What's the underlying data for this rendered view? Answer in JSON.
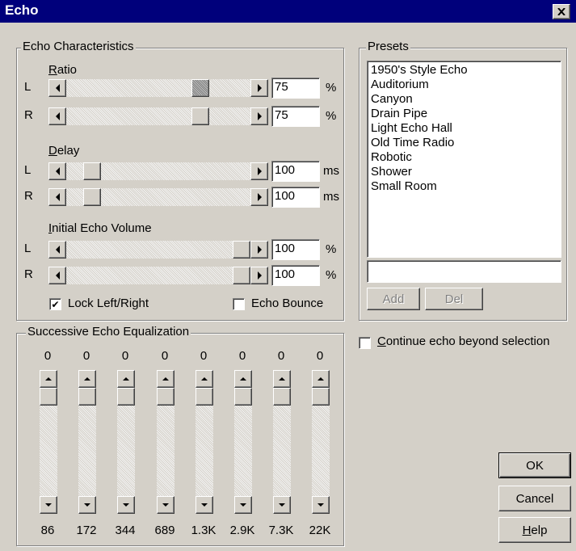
{
  "window": {
    "title": "Echo",
    "close_icon": "close-icon"
  },
  "echo_characteristics": {
    "group_label": "Echo Characteristics",
    "ratio": {
      "label": "Ratio",
      "left_value": "75",
      "right_value": "75",
      "unit": "%",
      "left_level": 0.75,
      "right_level": 0.75
    },
    "delay": {
      "label": "Delay",
      "left_value": "100",
      "right_value": "100",
      "unit": "ms",
      "left_level": 0.1,
      "right_level": 0.1
    },
    "initial_volume": {
      "label": "Initial Echo Volume",
      "left_value": "100",
      "right_value": "100",
      "unit": "%",
      "left_level": 1.0,
      "right_level": 1.0
    },
    "channel_left": "L",
    "channel_right": "R",
    "lock_left_right": {
      "label": "Lock Left/Right",
      "checked": true
    },
    "echo_bounce": {
      "label": "Echo Bounce",
      "checked": false
    }
  },
  "presets": {
    "group_label": "Presets",
    "items": [
      "1950's Style Echo",
      "Auditorium",
      "Canyon",
      "Drain Pipe",
      "Light Echo Hall",
      "Old Time Radio",
      "Robotic",
      "Shower",
      "Small Room"
    ],
    "name_value": "",
    "add_label": "Add",
    "del_label": "Del"
  },
  "equalization": {
    "group_label": "Successive Echo Equalization",
    "bands": [
      {
        "value": "0",
        "freq": "86"
      },
      {
        "value": "0",
        "freq": "172"
      },
      {
        "value": "0",
        "freq": "344"
      },
      {
        "value": "0",
        "freq": "689"
      },
      {
        "value": "0",
        "freq": "1.3K"
      },
      {
        "value": "0",
        "freq": "2.9K"
      },
      {
        "value": "0",
        "freq": "7.3K"
      },
      {
        "value": "0",
        "freq": "22K"
      }
    ]
  },
  "continue_echo": {
    "label": "Continue echo beyond selection",
    "checked": false
  },
  "buttons": {
    "ok_label": "OK",
    "cancel_label": "Cancel",
    "help_label": "Help"
  }
}
